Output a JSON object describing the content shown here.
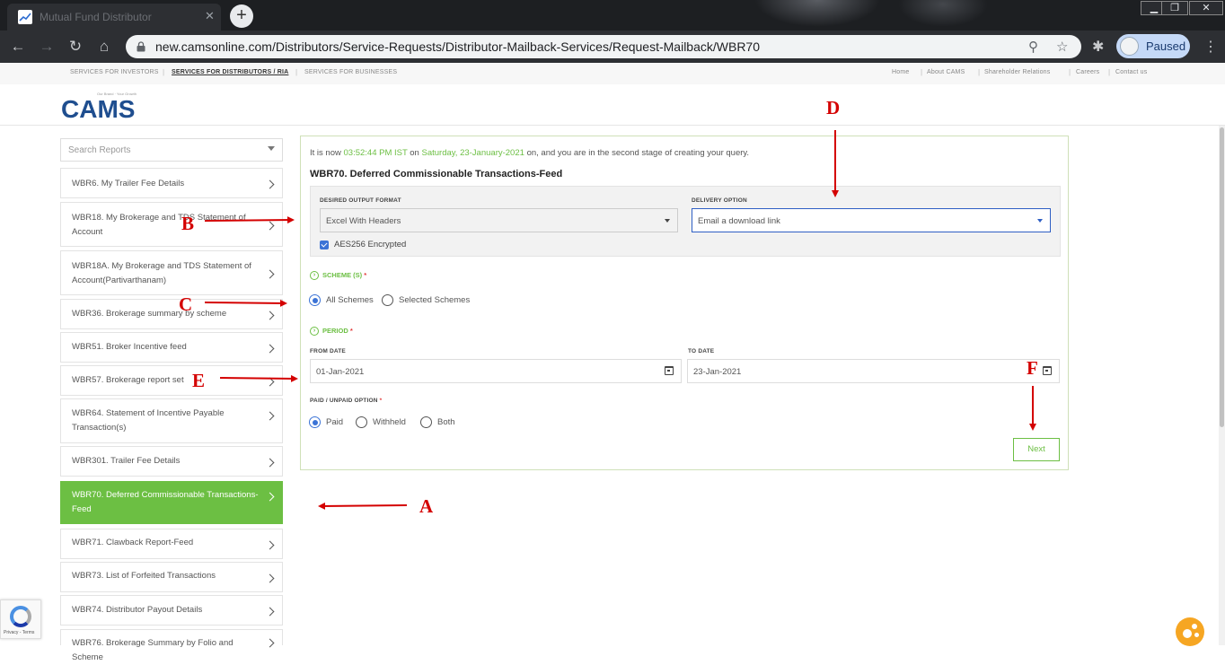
{
  "browser": {
    "tab_title": "Mutual Fund Distributor",
    "tab_close": "✕",
    "new_tab": "+",
    "url": "new.camsonline.com/Distributors/Service-Requests/Distributor-Mailback-Services/Request-Mailback/WBR70",
    "profile_label": "Paused",
    "window_controls": [
      "▁",
      "❐",
      "✕"
    ]
  },
  "topnav": {
    "left": [
      "SERVICES FOR INVESTORS",
      "SERVICES FOR DISTRIBUTORS / RIA",
      "SERVICES FOR BUSINESSES"
    ],
    "right": [
      "Home",
      "About CAMS",
      "Shareholder Relations",
      "Careers",
      "Contact us"
    ]
  },
  "logo": {
    "text": "CAMS",
    "tagline": "Our Brand · Your Growth"
  },
  "sidebar": {
    "search_placeholder": "Search Reports",
    "items": [
      {
        "label": "WBR6. My Trailer Fee Details"
      },
      {
        "label": "WBR18. My Brokerage and TDS Statement of Account"
      },
      {
        "label": "WBR18A. My Brokerage and TDS Statement of Account(Partivarthanam)"
      },
      {
        "label": "WBR36. Brokerage summary by scheme"
      },
      {
        "label": "WBR51. Broker Incentive feed"
      },
      {
        "label": "WBR57. Brokerage report set"
      },
      {
        "label": "WBR64. Statement of Incentive Payable Transaction(s)"
      },
      {
        "label": "WBR301. Trailer Fee Details"
      },
      {
        "label": "WBR70. Deferred Commissionable Transactions-Feed",
        "active": true
      },
      {
        "label": "WBR71. Clawback Report-Feed"
      },
      {
        "label": "WBR73. List of Forfeited Transactions"
      },
      {
        "label": "WBR74. Distributor Payout Details"
      },
      {
        "label": "WBR76. Brokerage Summary by Folio and Scheme"
      }
    ]
  },
  "main": {
    "status_prefix": "It is now",
    "status_time": "03:52:44 PM IST",
    "status_on": "on",
    "status_date": "Saturday, 23-January-2021",
    "status_suffix": "on, and you are in the second stage of creating your query.",
    "title": "WBR70. Deferred Commissionable Transactions-Feed",
    "output_format_label": "DESIRED OUTPUT FORMAT",
    "output_format_value": "Excel With Headers",
    "delivery_label": "DELIVERY OPTION",
    "delivery_value": "Email a download link",
    "encrypted_label": "AES256 Encrypted",
    "encrypted_checked": true,
    "scheme_heading": "SCHEME (S)",
    "scheme_options": [
      "All Schemes",
      "Selected Schemes"
    ],
    "scheme_selected": "All Schemes",
    "period_heading": "PERIOD",
    "required_mark": "*",
    "from_date_label": "FROM DATE",
    "from_date_value": "01-Jan-2021",
    "to_date_label": "TO DATE",
    "to_date_value": "23-Jan-2021",
    "paid_label": "PAID / UNPAID OPTION",
    "paid_options": [
      "Paid",
      "Withheld",
      "Both"
    ],
    "paid_selected": "Paid",
    "next_label": "Next"
  },
  "annotations": [
    "A",
    "B",
    "C",
    "D",
    "E",
    "F"
  ],
  "recaptcha_text": "Privacy - Terms",
  "colors": {
    "accent_green": "#6cbf43",
    "annotation_red": "#d40000",
    "focus_blue": "#2f5fc4"
  }
}
